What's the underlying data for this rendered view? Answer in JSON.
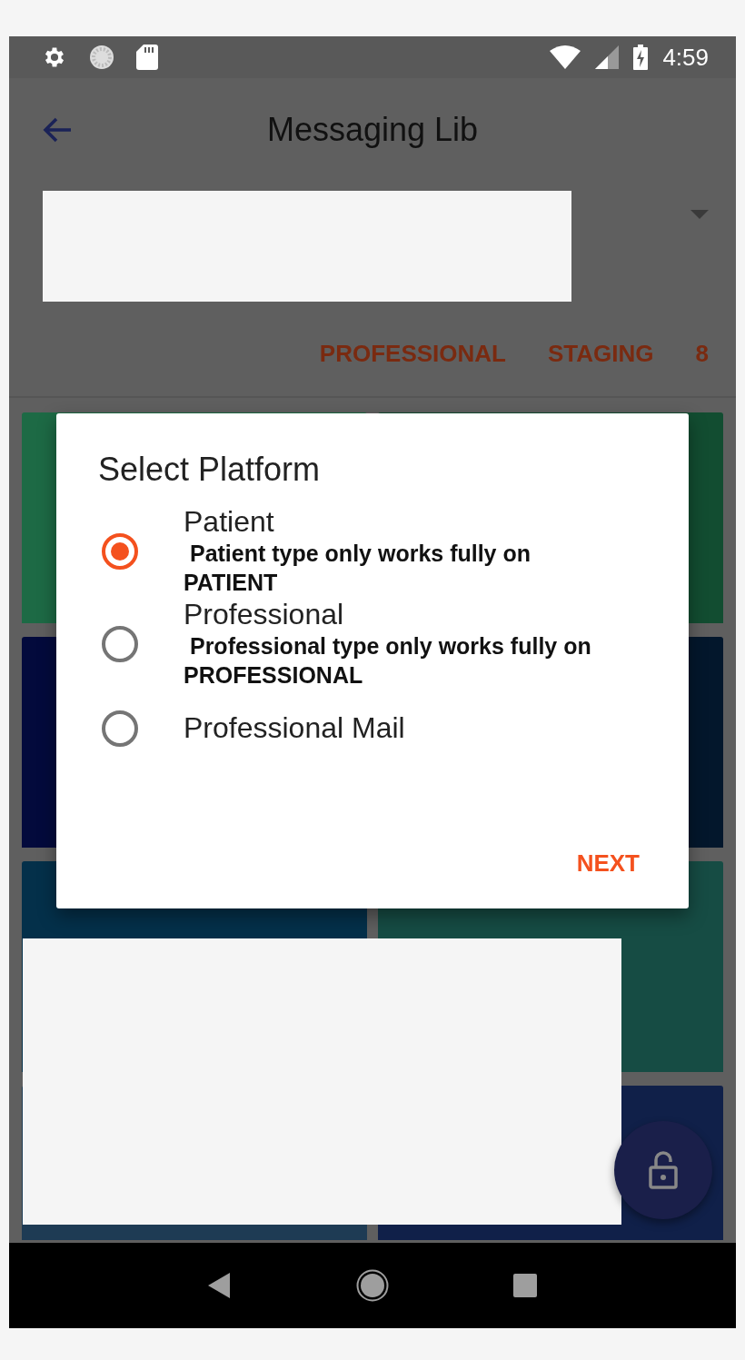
{
  "status_bar": {
    "time": "4:59"
  },
  "app_bar": {
    "title": "Messaging Lib"
  },
  "info_row": [
    "PROFESSIONAL",
    "STAGING",
    "8"
  ],
  "tiles": [
    {
      "color": "#1d6a45"
    },
    {
      "color": "#124d31"
    },
    {
      "color": "#030a3c"
    },
    {
      "color": "#03172c"
    },
    {
      "color": "#04304a"
    },
    {
      "color": "#164c44"
    },
    {
      "color": "#1e3b54"
    },
    {
      "color": "#102049"
    }
  ],
  "dialog": {
    "title": "Select Platform",
    "options": [
      {
        "label": "Patient",
        "description": " Patient type only works fully on\nPATIENT",
        "selected": true
      },
      {
        "label": "Professional",
        "description": " Professional type only works fully on\nPROFESSIONAL",
        "selected": false
      },
      {
        "label": "Professional Mail",
        "selected": false
      }
    ],
    "action": "NEXT"
  }
}
